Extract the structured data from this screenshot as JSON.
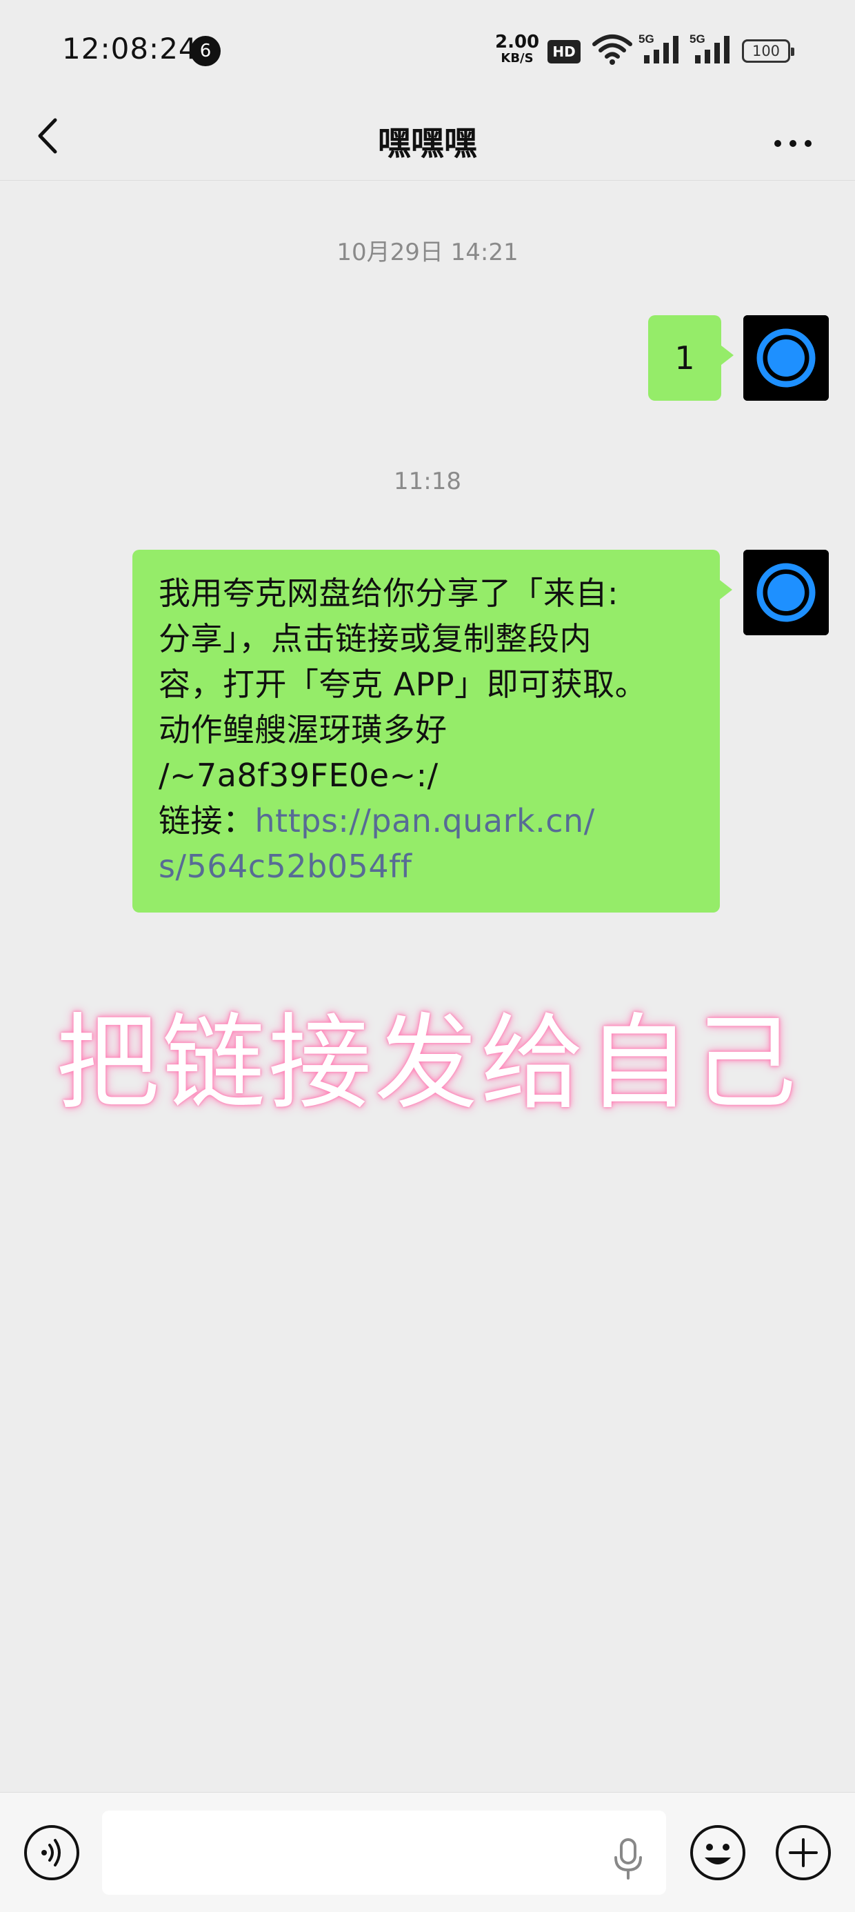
{
  "status_bar": {
    "time": "12:08:24",
    "notification_count": "6",
    "net_speed_value": "2.00",
    "net_speed_unit": "KB/S",
    "hd_label": "HD",
    "signal_label_1": "5G",
    "signal_label_2": "5G",
    "battery": "100"
  },
  "nav": {
    "title": "嘿嘿嘿",
    "back_icon": "chevron-left-icon",
    "more_icon": "more-horizontal-icon"
  },
  "messages": {
    "timestamp_1": "10月29日 14:21",
    "message_1": "1",
    "timestamp_2": "11:18",
    "message_2_lines": [
      "我用夸克网盘给你分享了「来自:",
      "分享」，点击链接或复制整段内",
      "容，打开「夸克 APP」即可获取。",
      "动作鳇艘渥玡璜多好",
      "/~7a8f39FE0e~:/"
    ],
    "message_2_link_label": "链接：",
    "message_2_link_line1": "https://pan.quark.cn/",
    "message_2_link_line2": "s/564c52b054ff"
  },
  "overlay_caption": "把链接发给自己",
  "input_bar": {
    "text_value": "",
    "voice_icon": "voice-icon",
    "mic_icon": "microphone-icon",
    "emoji_icon": "emoji-icon",
    "plus_icon": "plus-icon"
  },
  "colors": {
    "background": "#ededed",
    "bubble_green": "#95ec69",
    "link_blue": "#576b95",
    "avatar_ring": "#1e90ff",
    "caption_glow": "#ff7fb5"
  }
}
